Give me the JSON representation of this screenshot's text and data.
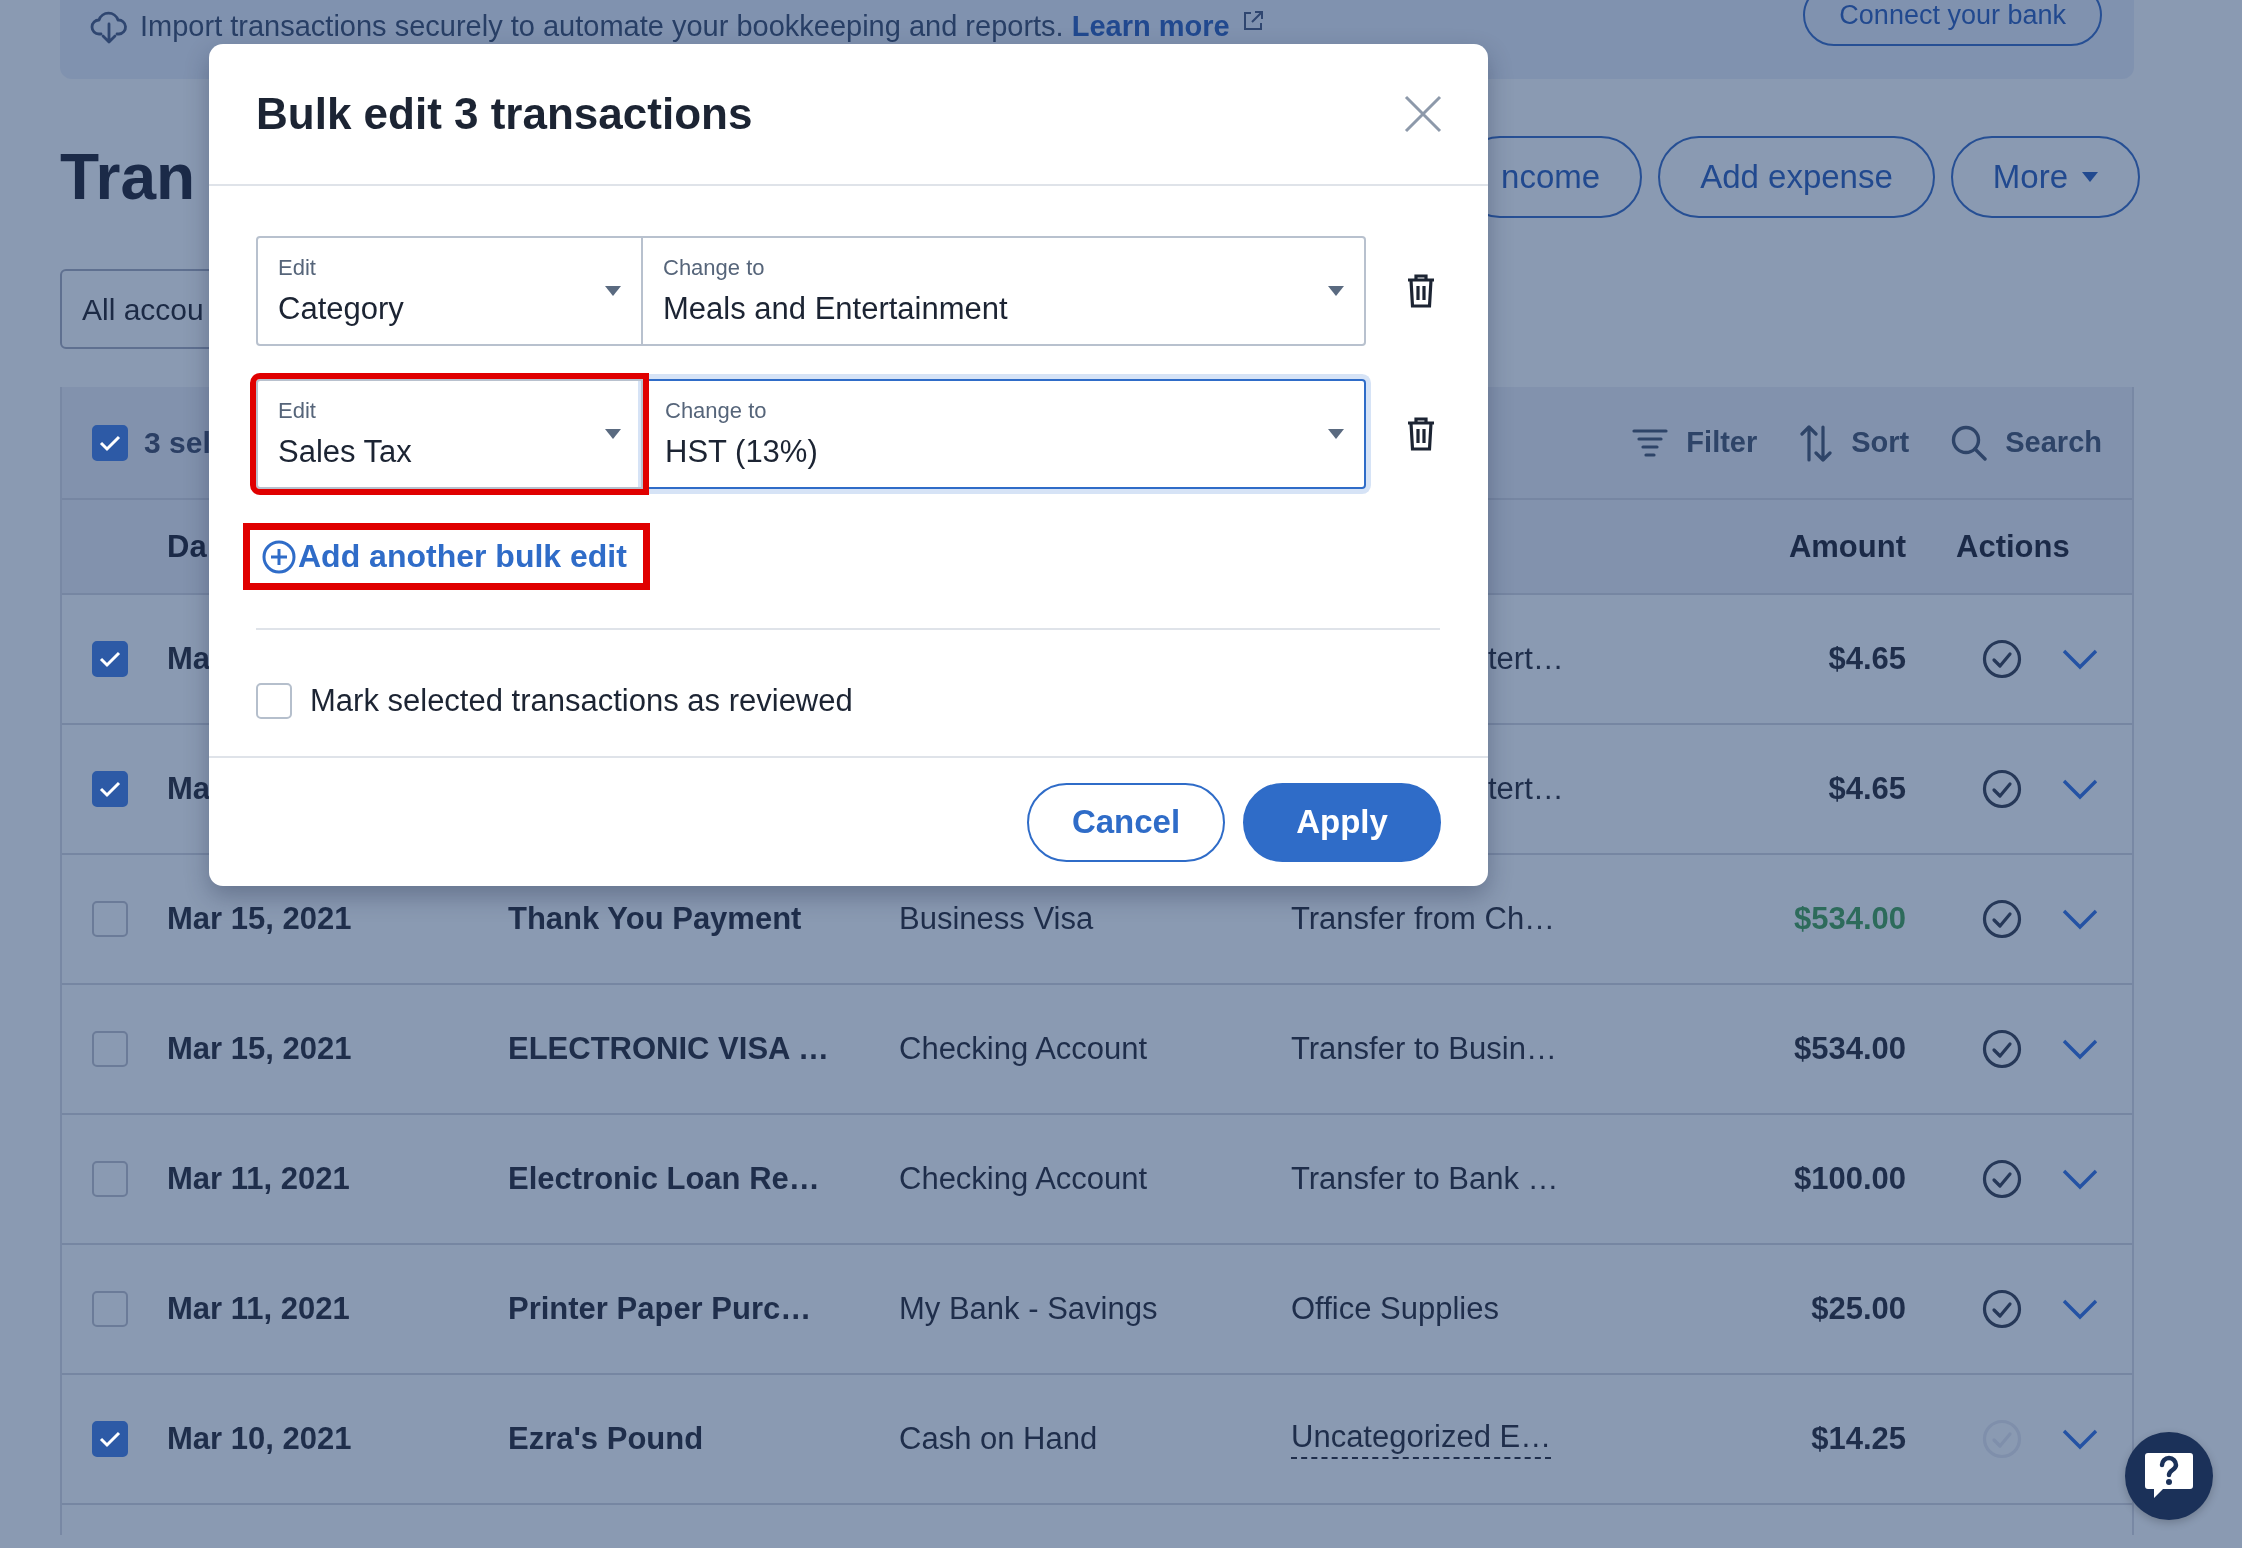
{
  "banner": {
    "text": "Import transactions securely to automate your bookkeeping and reports.",
    "link": "Learn more",
    "button": "Connect your bank"
  },
  "page": {
    "title": "Tran",
    "account_filter": "All accou",
    "buttons": [
      {
        "label": "ncome",
        "kind": "plain"
      },
      {
        "label": "Add expense",
        "kind": "plain"
      },
      {
        "label": "More",
        "kind": "dropdown"
      }
    ]
  },
  "table": {
    "select_all_checked": true,
    "selected_text": "3 sel",
    "tools": [
      {
        "label": "Filter",
        "kind": "filter"
      },
      {
        "label": "Sort",
        "kind": "sort"
      },
      {
        "label": "Search",
        "kind": "search"
      }
    ],
    "date_header": "Da",
    "amount_header": "Amount",
    "actions_header": "Actions",
    "rows": [
      {
        "kind": "covered",
        "checked": true,
        "date": "Ma",
        "category": "tert…",
        "amount": "$4.65",
        "incoming": false,
        "reviewed": true,
        "underlined": false
      },
      {
        "kind": "covered",
        "checked": true,
        "date": "Ma",
        "category": "tert…",
        "amount": "$4.65",
        "incoming": false,
        "reviewed": true,
        "underlined": false
      },
      {
        "kind": "full",
        "checked": false,
        "date": "Mar 15, 2021",
        "description": "Thank You Payment",
        "account": "Business Visa",
        "category": "Transfer from Ch…",
        "amount": "$534.00",
        "incoming": true,
        "reviewed": true,
        "underlined": false
      },
      {
        "kind": "full",
        "checked": false,
        "date": "Mar 15, 2021",
        "description": "ELECTRONIC VISA …",
        "account": "Checking Account",
        "category": "Transfer to Busin…",
        "amount": "$534.00",
        "incoming": false,
        "reviewed": true,
        "underlined": false
      },
      {
        "kind": "full",
        "checked": false,
        "date": "Mar 11, 2021",
        "description": "Electronic Loan Re…",
        "account": "Checking Account",
        "category": "Transfer to Bank …",
        "amount": "$100.00",
        "incoming": false,
        "reviewed": true,
        "underlined": false
      },
      {
        "kind": "full",
        "checked": false,
        "date": "Mar 11, 2021",
        "description": "Printer Paper Purc…",
        "account": "My Bank - Savings",
        "category": "Office Supplies",
        "amount": "$25.00",
        "incoming": false,
        "reviewed": true,
        "underlined": false
      },
      {
        "kind": "full",
        "checked": true,
        "date": "Mar 10, 2021",
        "description": "Ezra's Pound",
        "account": "Cash on Hand",
        "category": "Uncategorized E…",
        "amount": "$14.25",
        "incoming": false,
        "reviewed": false,
        "underlined": true
      }
    ]
  },
  "modal": {
    "title": "Bulk edit 3 transactions",
    "edits": [
      {
        "edit_label": "Edit",
        "field": "Category",
        "change_label": "Change to",
        "value": "Meals and Entertainment",
        "focused": false,
        "highlighted": false
      },
      {
        "edit_label": "Edit",
        "field": "Sales Tax",
        "change_label": "Change to",
        "value": "HST (13%)",
        "focused": true,
        "highlighted": true
      }
    ],
    "add_link": {
      "label": "Add another bulk edit",
      "highlighted": true
    },
    "mark_reviewed": {
      "label": "Mark selected transactions as reviewed",
      "checked": false
    },
    "buttons": [
      {
        "label": "Cancel",
        "kind": "secondary"
      },
      {
        "label": "Apply",
        "kind": "primary"
      }
    ]
  }
}
